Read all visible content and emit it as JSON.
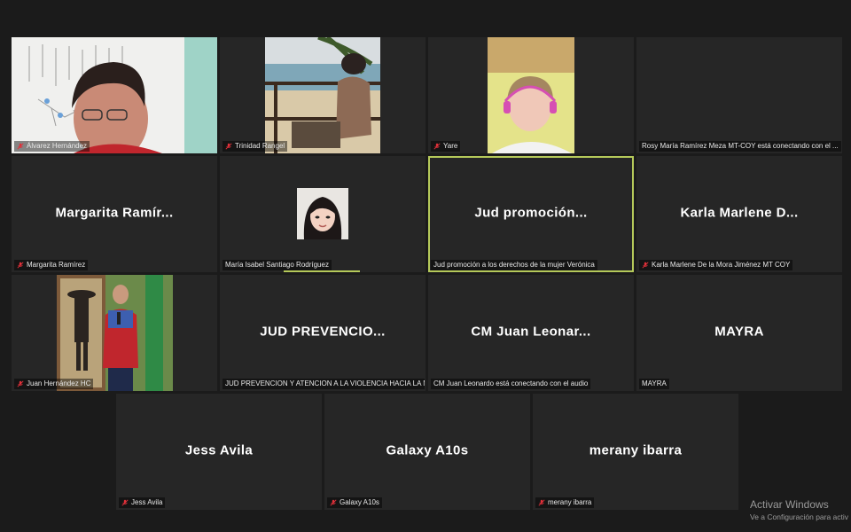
{
  "participants": [
    {
      "big_name": "",
      "label": "Álvarez Hernández",
      "active": false
    },
    {
      "big_name": "",
      "label": "Trinidad Rangel",
      "active": false
    },
    {
      "big_name": "",
      "label": "Yare",
      "active": false
    },
    {
      "big_name": "",
      "label": "Rosy María Ramírez Meza MT-COY está conectando con el ...",
      "active": false
    },
    {
      "big_name": "Margarita Ramír...",
      "label": "Margarita Ramírez",
      "active": false
    },
    {
      "big_name": "",
      "label": "María Isabel Santiago Rodríguez",
      "active": false
    },
    {
      "big_name": "Jud promoción...",
      "label": "Jud promoción a los derechos de la mujer Verónica",
      "active": true
    },
    {
      "big_name": "Karla Marlene D...",
      "label": "Karla Marlene De la Mora Jiménez MT COY",
      "active": false
    },
    {
      "big_name": "",
      "label": "Juan Hernández HC",
      "active": false
    },
    {
      "big_name": "JUD PREVENCIO...",
      "label": "JUD PREVENCION Y ATENCION A LA VIOLENCIA HACIA LA MUJ...",
      "active": false
    },
    {
      "big_name": "CM Juan Leonar...",
      "label": "CM Juan Leonardo está conectando con el audio",
      "active": false
    },
    {
      "big_name": "MAYRA",
      "label": "MAYRA",
      "active": false
    },
    {
      "big_name": "Jess Avila",
      "label": "Jess Avila",
      "active": false
    },
    {
      "big_name": "Galaxy A10s",
      "label": "Galaxy A10s",
      "active": false
    },
    {
      "big_name": "merany ibarra",
      "label": "merany ibarra",
      "active": false
    }
  ],
  "watermark": {
    "line1": "Activar Windows",
    "line2": "Ve a Configuración para activ"
  },
  "colors": {
    "active_border": "#b5c95a",
    "tile_bg": "#262626",
    "mute_red": "#e0303a"
  }
}
